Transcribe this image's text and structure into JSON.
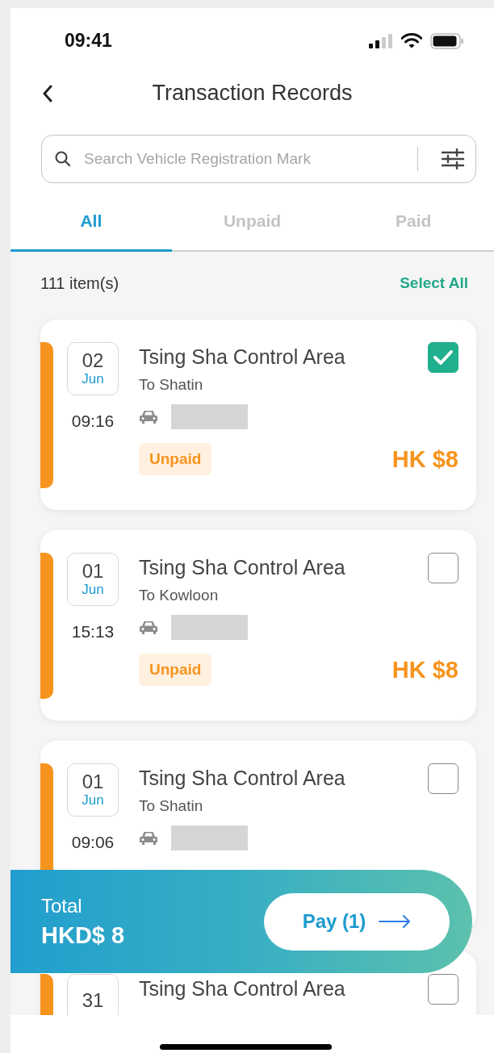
{
  "status_bar": {
    "time": "09:41"
  },
  "header": {
    "title": "Transaction Records"
  },
  "search": {
    "placeholder": "Search Vehicle Registration Mark"
  },
  "tabs": [
    {
      "label": "All",
      "selected": true
    },
    {
      "label": "Unpaid",
      "selected": false
    },
    {
      "label": "Paid",
      "selected": false
    }
  ],
  "list": {
    "count": "111 item(s)",
    "select_all": "Select All"
  },
  "records": [
    {
      "day": "02",
      "month": "Jun",
      "time": "09:16",
      "location": "Tsing Sha Control Area",
      "direction": "To Shatin",
      "status": "Unpaid",
      "amount": "HK $8",
      "checked": true
    },
    {
      "day": "01",
      "month": "Jun",
      "time": "15:13",
      "location": "Tsing Sha Control Area",
      "direction": "To Kowloon",
      "status": "Unpaid",
      "amount": "HK $8",
      "checked": false
    },
    {
      "day": "01",
      "month": "Jun",
      "time": "09:06",
      "location": "Tsing Sha Control Area",
      "direction": "To Shatin",
      "checked": false
    },
    {
      "day": "31",
      "location": "Tsing Sha Control Area",
      "checked": false
    }
  ],
  "footer": {
    "total_label": "Total",
    "total": "HKD$ 8",
    "pay_button": "Pay (1)"
  }
}
